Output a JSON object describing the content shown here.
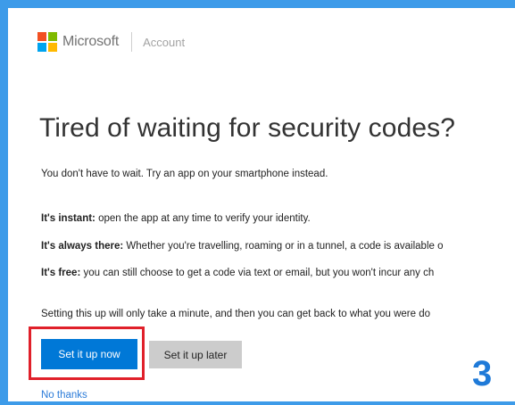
{
  "header": {
    "brand": "Microsoft",
    "section": "Account",
    "logo_colors": [
      "#f25022",
      "#7fba00",
      "#00a4ef",
      "#ffb900"
    ]
  },
  "main": {
    "title": "Tired of waiting for security codes?",
    "intro": "You don't have to wait. Try an app on your smartphone instead.",
    "benefits": [
      {
        "label": "It's instant:",
        "text": " open the app at any time to verify your identity."
      },
      {
        "label": "It's always there:",
        "text": " Whether you're travelling, roaming or in a tunnel, a code is available o"
      },
      {
        "label": "It's free:",
        "text": " you can still choose to get a code via text or email, but you won't incur any ch"
      }
    ],
    "note": "Setting this up will only take a minute, and then you can get back to what you were do",
    "buttons": {
      "primary": "Set it up now",
      "secondary": "Set it up later"
    },
    "decline_link": "No thanks"
  },
  "annotation": {
    "step_number": "3",
    "highlight_color": "#e0202a"
  },
  "colors": {
    "frame": "#3d9be9",
    "primary_button": "#0078d7",
    "secondary_button": "#cccccc",
    "link": "#2b7bd8",
    "step_number": "#1f7ad8"
  }
}
